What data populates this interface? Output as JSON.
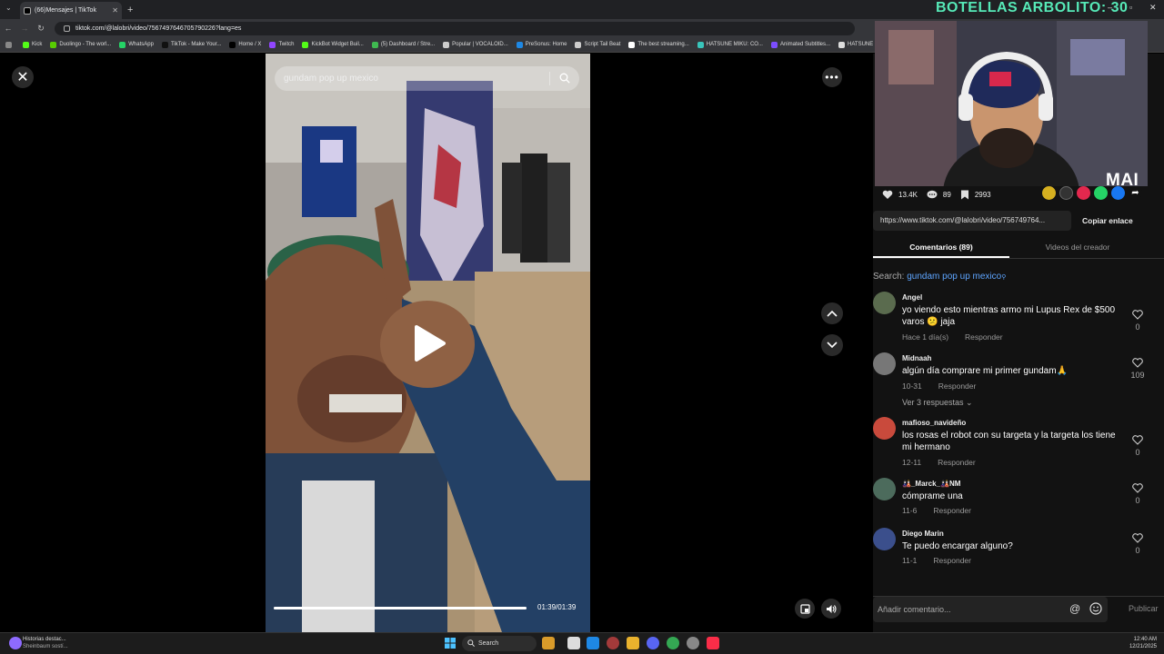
{
  "browser": {
    "tab_title": "(66)Mensajes | TikTok",
    "url": "tiktok.com/@lalobri/video/7567497646705790226?lang=es",
    "bookmarks": [
      {
        "label": "Kick",
        "color": "#53fc18"
      },
      {
        "label": "Duolingo - The worl...",
        "color": "#58cc02"
      },
      {
        "label": "WhatsApp",
        "color": "#25d366"
      },
      {
        "label": "TikTok - Make Your...",
        "color": "#111111"
      },
      {
        "label": "Home / X",
        "color": "#000000"
      },
      {
        "label": "Twitch",
        "color": "#9146ff"
      },
      {
        "label": "KickBot Widget Buil...",
        "color": "#53fc18"
      },
      {
        "label": "(5) Dashboard / Stre...",
        "color": "#3fb950"
      },
      {
        "label": "Popular | VOCALOID...",
        "color": "#cccccc"
      },
      {
        "label": "PreSonus: Home",
        "color": "#1e88e5"
      },
      {
        "label": "Script Tail Beat",
        "color": "#cccccc"
      },
      {
        "label": "The best streaming...",
        "color": "#ffffff"
      },
      {
        "label": "HATSUNE MIKU: CO...",
        "color": "#39c5bb"
      },
      {
        "label": "Animated Subtitles...",
        "color": "#7c4dff"
      },
      {
        "label": "HATSUNE M",
        "color": "#dddddd"
      }
    ]
  },
  "video": {
    "search_query": "gundam pop up mexico",
    "time": "01:39/01:39",
    "progress": 1.0
  },
  "panel": {
    "likes": "13.4K",
    "comments_count": "89",
    "saves": "2993",
    "link": "https://www.tiktok.com/@lalobri/video/756749764...",
    "copy_link": "Copiar enlace",
    "tab_comments": "Comentarios (89)",
    "tab_creator": "Videos del creador",
    "search_label": "Search:",
    "search_query": "gundam pop up mexico",
    "comments": [
      {
        "name": "Angel",
        "text": "yo viendo esto mientras armo mi Lupus Rex de $500 varos 😕 jaja",
        "date": "Hace 1 día(s)",
        "reply": "Responder",
        "likes": "0",
        "avatar": "#5a6b4e"
      },
      {
        "name": "Midnaah",
        "text": "algún día comprare mi primer gundam🙏",
        "date": "10-31",
        "reply": "Responder",
        "likes": "109",
        "avatar": "#777777",
        "more": "Ver 3 respuestas ⌄"
      },
      {
        "name": "mafioso_navideño",
        "text": "los rosas el robot con su targeta y la targeta los tiene mi hermano",
        "date": "12-11",
        "reply": "Responder",
        "likes": "0",
        "avatar": "#c94a3c"
      },
      {
        "name": "🎎_Marck_🎎NM",
        "text": "cómprame una",
        "date": "11-6",
        "reply": "Responder",
        "likes": "0",
        "avatar": "#4c6b5c"
      },
      {
        "name": "Diego Marin",
        "text": "Te puedo encargar alguno?",
        "date": "11-1",
        "reply": "Responder",
        "likes": "0",
        "avatar": "#3b4f8c"
      }
    ],
    "add_comment": "Añadir comentario...",
    "publish": "Publicar"
  },
  "overlay": {
    "title": "BOTELLAS ARBOLITO: 30",
    "logo": "MAI"
  },
  "taskbar": {
    "news_title": "Historias destac...",
    "news_sub": "Sheinbaum sostí...",
    "search": "Search",
    "time": "12:40 AM",
    "date": "12/21/2025"
  }
}
